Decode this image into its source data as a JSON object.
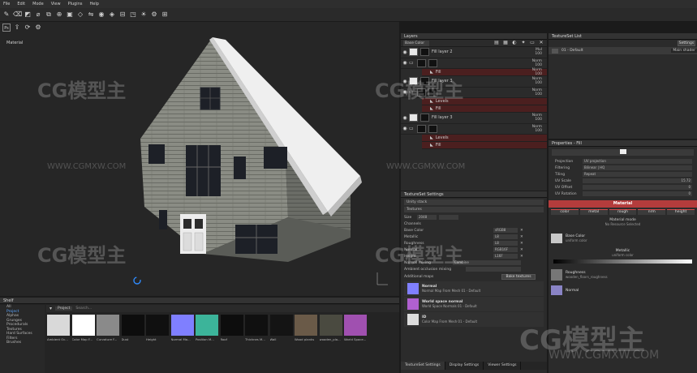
{
  "menu": [
    "File",
    "Edit",
    "Mode",
    "View",
    "Plugins",
    "Help"
  ],
  "viewport": {
    "label": "Material"
  },
  "layers": {
    "title": "Layers",
    "blend_select": "Base Color",
    "rows": [
      {
        "name": "Fill layer 2",
        "val1": "Mul",
        "val2": "100",
        "type": "fill"
      },
      {
        "name": "",
        "val1": "Norm",
        "val2": "100",
        "type": "folder"
      },
      {
        "name": "Fill",
        "val1": "Norm",
        "val2": "100",
        "type": "effect"
      },
      {
        "name": "Fill layer 3",
        "val1": "Norm",
        "val2": "100",
        "type": "fill"
      },
      {
        "name": "",
        "val1": "Norm",
        "val2": "100",
        "type": "folder"
      },
      {
        "name": "Levels",
        "val1": "",
        "val2": "",
        "type": "effect"
      },
      {
        "name": "Fill",
        "val1": "",
        "val2": "",
        "type": "effect"
      },
      {
        "name": "Fill layer 3",
        "val1": "Norm",
        "val2": "100",
        "type": "fill"
      },
      {
        "name": "",
        "val1": "Norm",
        "val2": "100",
        "type": "folder"
      },
      {
        "name": "Levels",
        "val1": "",
        "val2": "",
        "type": "effect"
      },
      {
        "name": "Fill",
        "val1": "",
        "val2": "",
        "type": "effect"
      }
    ]
  },
  "textureset_settings": {
    "title": "TextureSet Settings",
    "stack": "Unity stack",
    "textures": "Textures",
    "size_label": "Size",
    "size_value": "2048",
    "channels_label": "Channels",
    "channels": [
      {
        "name": "Base Color",
        "format": "sRGB8"
      },
      {
        "name": "Metallic",
        "format": "L8"
      },
      {
        "name": "Roughness",
        "format": "L8"
      },
      {
        "name": "Normal",
        "format": "RGB16F"
      },
      {
        "name": "Height",
        "format": "L16F"
      }
    ],
    "normal_mixing_label": "Normal mixing",
    "normal_mixing_value": "Combine",
    "ao_mixing_label": "Ambient occlusion mixing",
    "additional_maps_label": "Additional maps",
    "bake_button": "Bake textures",
    "maps": [
      {
        "title": "Normal",
        "sub": "Normal Map From Mesh 01 - Default",
        "color": "#8080ff"
      },
      {
        "title": "World space normal",
        "sub": "World Space Normals 01 - Default",
        "color": "#b060d0"
      },
      {
        "title": "ID",
        "sub": "Color Map From Mesh 01 - Default",
        "color": "#dcdcdc"
      }
    ]
  },
  "bottom_tabs": [
    "TextureSet Settings",
    "Display Settings",
    "Viewer Settings"
  ],
  "textureset_list": {
    "title": "TextureSet List",
    "settings_button": "Settings",
    "main_shader_button": "Main shader",
    "entry": "01 - Default"
  },
  "properties": {
    "title": "Properties - Fill",
    "projection_label": "Projection",
    "projection_value": "UV projection",
    "filtering_label": "Filtering",
    "filtering_value": "Bilinear | HQ",
    "tiling_label": "Tiling",
    "tiling_value": "Repeat",
    "uv_scale_label": "UV Scale",
    "uv_scale_value": "15.72",
    "uv_offset_label": "UV Offset",
    "uv_offset_value": "0",
    "uv_rotation_label": "UV Rotation",
    "uv_rotation_value": "0",
    "material_header": "Material",
    "material_chips": [
      "color",
      "metal",
      "rough",
      "nrm",
      "height"
    ],
    "material_mode": "Material mode",
    "material_none": "No Resource Selected",
    "base_color_title": "Base Color",
    "base_color_sub": "uniform color",
    "metallic_title": "Metallic",
    "metallic_sub": "uniform color",
    "roughness_title": "Roughness",
    "roughness_sub": "wooden_floors_roughness",
    "normal_title": "Normal"
  },
  "shelf": {
    "title": "Shelf",
    "categories": [
      "All",
      "Project",
      "Alphas",
      "Grunges",
      "Procedurals",
      "Textures",
      "Hard Surfaces",
      "Filters",
      "Brushes"
    ],
    "selected_category": "Project",
    "filter_label": "Project",
    "search_placeholder": "Search...",
    "items": [
      {
        "name": "Ambient Oc...",
        "color": "#d9d9d9"
      },
      {
        "name": "Color Map F...",
        "color": "#ffffff"
      },
      {
        "name": "Curvature F...",
        "color": "#8a8a8a"
      },
      {
        "name": "Dust",
        "color": "#0d0d0d"
      },
      {
        "name": "Height",
        "color": "#101010"
      },
      {
        "name": "Normal Ma...",
        "color": "#7f7fff"
      },
      {
        "name": "Position M...",
        "color": "#3cb49a"
      },
      {
        "name": "Roof",
        "color": "#0d0d0d"
      },
      {
        "name": "Thicknes M...",
        "color": "#101010"
      },
      {
        "name": "Wall",
        "color": "#141414"
      },
      {
        "name": "Wood planks",
        "color": "#6a5a48"
      },
      {
        "name": "wooden_pla...",
        "color": "#4a4a40"
      },
      {
        "name": "World Space...",
        "color": "#a050b0"
      }
    ]
  },
  "watermark": {
    "brand": "CG模型主",
    "url": "WWW.CGMXW.COM"
  }
}
